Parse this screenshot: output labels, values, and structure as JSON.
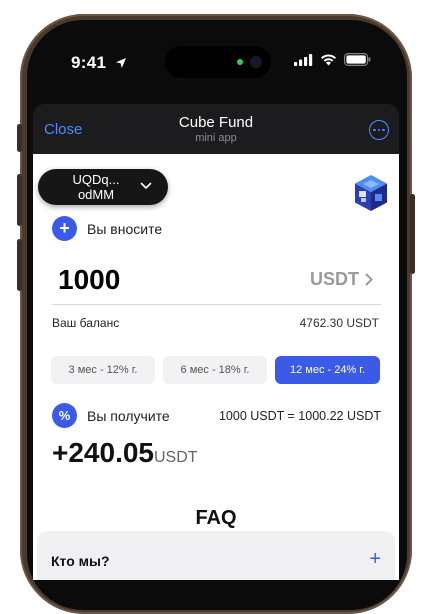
{
  "status_bar": {
    "time": "9:41"
  },
  "header": {
    "close_label": "Close",
    "title": "Cube Fund",
    "subtitle": "mini app"
  },
  "wallet": {
    "address_line1": "UQDq...",
    "address_line2": "odMM"
  },
  "deposit": {
    "label": "Вы вносите",
    "amount": "1000",
    "currency": "USDT",
    "balance_label": "Ваш баланс",
    "balance_value": "4762.30  USDT"
  },
  "periods": {
    "items": [
      {
        "label": "3 мес - 12% г."
      },
      {
        "label": "6 мес - 18% г."
      },
      {
        "label": "12 мес - 24% г."
      }
    ],
    "selected": "12 мес - 24% г."
  },
  "receive": {
    "label": "Вы получите",
    "rate": "1000 USDT = 1000.22 USDT",
    "profit": "+240.05",
    "profit_currency": "USDT"
  },
  "faq": {
    "title": "FAQ",
    "items": [
      {
        "question": "Кто мы?"
      }
    ]
  },
  "colors": {
    "accent": "#3b5ae8",
    "telegram_link": "#4a8bff",
    "frame": "#4a3a2e"
  }
}
